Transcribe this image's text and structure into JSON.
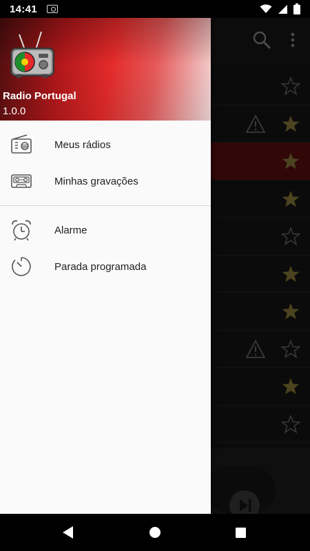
{
  "status_bar": {
    "time": "14:41",
    "icons": [
      "radio-notification-icon",
      "wifi-icon",
      "cellular-signal-icon",
      "battery-icon"
    ]
  },
  "background_app": {
    "toolbar_icons": [
      "search-icon",
      "more-vert-icon"
    ],
    "list_rows": [
      {
        "starred": false,
        "warning": false,
        "selected": false
      },
      {
        "starred": true,
        "warning": true,
        "selected": false
      },
      {
        "starred": true,
        "warning": false,
        "selected": true
      },
      {
        "starred": true,
        "warning": false,
        "selected": false
      },
      {
        "starred": false,
        "warning": false,
        "selected": false
      },
      {
        "starred": true,
        "warning": false,
        "selected": false
      },
      {
        "starred": true,
        "warning": false,
        "selected": false
      },
      {
        "starred": false,
        "warning": true,
        "selected": false
      },
      {
        "starred": true,
        "warning": false,
        "selected": false
      },
      {
        "starred": false,
        "warning": false,
        "selected": false
      }
    ]
  },
  "drawer": {
    "header": {
      "app_name": "Radio Portugal",
      "version": "1.0.0",
      "logo_icon": "portugal-radio-logo"
    },
    "menu": {
      "group1": [
        {
          "icon": "radio-icon",
          "label": "Meus rádios"
        },
        {
          "icon": "cassette-icon",
          "label": "Minhas gravações"
        }
      ],
      "group2": [
        {
          "icon": "alarm-clock-icon",
          "label": "Alarme"
        },
        {
          "icon": "timer-icon",
          "label": "Parada programada"
        }
      ]
    }
  },
  "nav_bar": {
    "icons": [
      "back-icon",
      "home-icon",
      "recents-icon"
    ]
  },
  "colors": {
    "accent_red": "#e52a2a",
    "star_gold": "#8a7a3a",
    "drawer_bg": "#fafafa",
    "selected_row": "#5a0e10"
  }
}
